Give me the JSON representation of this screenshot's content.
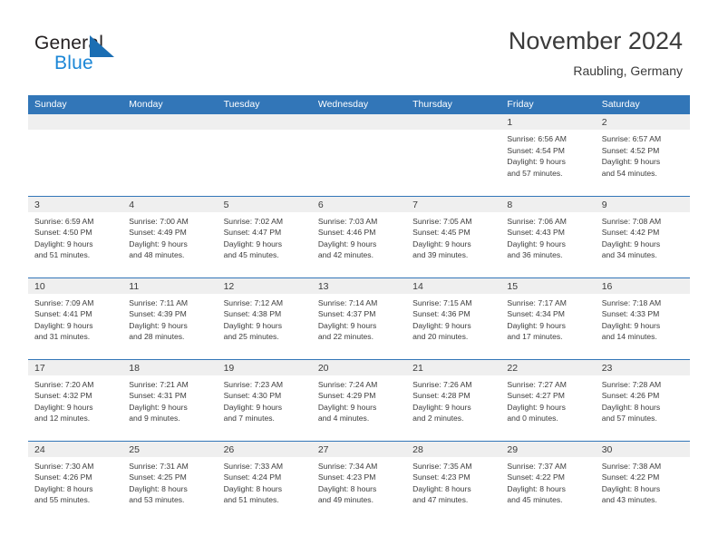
{
  "logo": {
    "word_one": "General",
    "word_two": "Blue",
    "triangle_color": "#1b6eb3",
    "word_two_color": "#1b86d6"
  },
  "header": {
    "title": "November 2024",
    "subtitle": "Raubling, Germany"
  },
  "colors": {
    "header_bar": "#3276b8",
    "daynum_band": "#efefef",
    "row_divider": "#3276b8",
    "text": "#3b3b3b"
  },
  "weekday_headers": [
    "Sunday",
    "Monday",
    "Tuesday",
    "Wednesday",
    "Thursday",
    "Friday",
    "Saturday"
  ],
  "weeks": [
    [
      {
        "day": "",
        "empty": true,
        "sunrise": "",
        "sunset": "",
        "daylight_line1": "",
        "daylight_line2": ""
      },
      {
        "day": "",
        "empty": true,
        "sunrise": "",
        "sunset": "",
        "daylight_line1": "",
        "daylight_line2": ""
      },
      {
        "day": "",
        "empty": true,
        "sunrise": "",
        "sunset": "",
        "daylight_line1": "",
        "daylight_line2": ""
      },
      {
        "day": "",
        "empty": true,
        "sunrise": "",
        "sunset": "",
        "daylight_line1": "",
        "daylight_line2": ""
      },
      {
        "day": "",
        "empty": true,
        "sunrise": "",
        "sunset": "",
        "daylight_line1": "",
        "daylight_line2": ""
      },
      {
        "day": "1",
        "empty": false,
        "sunrise": "Sunrise: 6:56 AM",
        "sunset": "Sunset: 4:54 PM",
        "daylight_line1": "Daylight: 9 hours",
        "daylight_line2": "and 57 minutes."
      },
      {
        "day": "2",
        "empty": false,
        "sunrise": "Sunrise: 6:57 AM",
        "sunset": "Sunset: 4:52 PM",
        "daylight_line1": "Daylight: 9 hours",
        "daylight_line2": "and 54 minutes."
      }
    ],
    [
      {
        "day": "3",
        "empty": false,
        "sunrise": "Sunrise: 6:59 AM",
        "sunset": "Sunset: 4:50 PM",
        "daylight_line1": "Daylight: 9 hours",
        "daylight_line2": "and 51 minutes."
      },
      {
        "day": "4",
        "empty": false,
        "sunrise": "Sunrise: 7:00 AM",
        "sunset": "Sunset: 4:49 PM",
        "daylight_line1": "Daylight: 9 hours",
        "daylight_line2": "and 48 minutes."
      },
      {
        "day": "5",
        "empty": false,
        "sunrise": "Sunrise: 7:02 AM",
        "sunset": "Sunset: 4:47 PM",
        "daylight_line1": "Daylight: 9 hours",
        "daylight_line2": "and 45 minutes."
      },
      {
        "day": "6",
        "empty": false,
        "sunrise": "Sunrise: 7:03 AM",
        "sunset": "Sunset: 4:46 PM",
        "daylight_line1": "Daylight: 9 hours",
        "daylight_line2": "and 42 minutes."
      },
      {
        "day": "7",
        "empty": false,
        "sunrise": "Sunrise: 7:05 AM",
        "sunset": "Sunset: 4:45 PM",
        "daylight_line1": "Daylight: 9 hours",
        "daylight_line2": "and 39 minutes."
      },
      {
        "day": "8",
        "empty": false,
        "sunrise": "Sunrise: 7:06 AM",
        "sunset": "Sunset: 4:43 PM",
        "daylight_line1": "Daylight: 9 hours",
        "daylight_line2": "and 36 minutes."
      },
      {
        "day": "9",
        "empty": false,
        "sunrise": "Sunrise: 7:08 AM",
        "sunset": "Sunset: 4:42 PM",
        "daylight_line1": "Daylight: 9 hours",
        "daylight_line2": "and 34 minutes."
      }
    ],
    [
      {
        "day": "10",
        "empty": false,
        "sunrise": "Sunrise: 7:09 AM",
        "sunset": "Sunset: 4:41 PM",
        "daylight_line1": "Daylight: 9 hours",
        "daylight_line2": "and 31 minutes."
      },
      {
        "day": "11",
        "empty": false,
        "sunrise": "Sunrise: 7:11 AM",
        "sunset": "Sunset: 4:39 PM",
        "daylight_line1": "Daylight: 9 hours",
        "daylight_line2": "and 28 minutes."
      },
      {
        "day": "12",
        "empty": false,
        "sunrise": "Sunrise: 7:12 AM",
        "sunset": "Sunset: 4:38 PM",
        "daylight_line1": "Daylight: 9 hours",
        "daylight_line2": "and 25 minutes."
      },
      {
        "day": "13",
        "empty": false,
        "sunrise": "Sunrise: 7:14 AM",
        "sunset": "Sunset: 4:37 PM",
        "daylight_line1": "Daylight: 9 hours",
        "daylight_line2": "and 22 minutes."
      },
      {
        "day": "14",
        "empty": false,
        "sunrise": "Sunrise: 7:15 AM",
        "sunset": "Sunset: 4:36 PM",
        "daylight_line1": "Daylight: 9 hours",
        "daylight_line2": "and 20 minutes."
      },
      {
        "day": "15",
        "empty": false,
        "sunrise": "Sunrise: 7:17 AM",
        "sunset": "Sunset: 4:34 PM",
        "daylight_line1": "Daylight: 9 hours",
        "daylight_line2": "and 17 minutes."
      },
      {
        "day": "16",
        "empty": false,
        "sunrise": "Sunrise: 7:18 AM",
        "sunset": "Sunset: 4:33 PM",
        "daylight_line1": "Daylight: 9 hours",
        "daylight_line2": "and 14 minutes."
      }
    ],
    [
      {
        "day": "17",
        "empty": false,
        "sunrise": "Sunrise: 7:20 AM",
        "sunset": "Sunset: 4:32 PM",
        "daylight_line1": "Daylight: 9 hours",
        "daylight_line2": "and 12 minutes."
      },
      {
        "day": "18",
        "empty": false,
        "sunrise": "Sunrise: 7:21 AM",
        "sunset": "Sunset: 4:31 PM",
        "daylight_line1": "Daylight: 9 hours",
        "daylight_line2": "and 9 minutes."
      },
      {
        "day": "19",
        "empty": false,
        "sunrise": "Sunrise: 7:23 AM",
        "sunset": "Sunset: 4:30 PM",
        "daylight_line1": "Daylight: 9 hours",
        "daylight_line2": "and 7 minutes."
      },
      {
        "day": "20",
        "empty": false,
        "sunrise": "Sunrise: 7:24 AM",
        "sunset": "Sunset: 4:29 PM",
        "daylight_line1": "Daylight: 9 hours",
        "daylight_line2": "and 4 minutes."
      },
      {
        "day": "21",
        "empty": false,
        "sunrise": "Sunrise: 7:26 AM",
        "sunset": "Sunset: 4:28 PM",
        "daylight_line1": "Daylight: 9 hours",
        "daylight_line2": "and 2 minutes."
      },
      {
        "day": "22",
        "empty": false,
        "sunrise": "Sunrise: 7:27 AM",
        "sunset": "Sunset: 4:27 PM",
        "daylight_line1": "Daylight: 9 hours",
        "daylight_line2": "and 0 minutes."
      },
      {
        "day": "23",
        "empty": false,
        "sunrise": "Sunrise: 7:28 AM",
        "sunset": "Sunset: 4:26 PM",
        "daylight_line1": "Daylight: 8 hours",
        "daylight_line2": "and 57 minutes."
      }
    ],
    [
      {
        "day": "24",
        "empty": false,
        "sunrise": "Sunrise: 7:30 AM",
        "sunset": "Sunset: 4:26 PM",
        "daylight_line1": "Daylight: 8 hours",
        "daylight_line2": "and 55 minutes."
      },
      {
        "day": "25",
        "empty": false,
        "sunrise": "Sunrise: 7:31 AM",
        "sunset": "Sunset: 4:25 PM",
        "daylight_line1": "Daylight: 8 hours",
        "daylight_line2": "and 53 minutes."
      },
      {
        "day": "26",
        "empty": false,
        "sunrise": "Sunrise: 7:33 AM",
        "sunset": "Sunset: 4:24 PM",
        "daylight_line1": "Daylight: 8 hours",
        "daylight_line2": "and 51 minutes."
      },
      {
        "day": "27",
        "empty": false,
        "sunrise": "Sunrise: 7:34 AM",
        "sunset": "Sunset: 4:23 PM",
        "daylight_line1": "Daylight: 8 hours",
        "daylight_line2": "and 49 minutes."
      },
      {
        "day": "28",
        "empty": false,
        "sunrise": "Sunrise: 7:35 AM",
        "sunset": "Sunset: 4:23 PM",
        "daylight_line1": "Daylight: 8 hours",
        "daylight_line2": "and 47 minutes."
      },
      {
        "day": "29",
        "empty": false,
        "sunrise": "Sunrise: 7:37 AM",
        "sunset": "Sunset: 4:22 PM",
        "daylight_line1": "Daylight: 8 hours",
        "daylight_line2": "and 45 minutes."
      },
      {
        "day": "30",
        "empty": false,
        "sunrise": "Sunrise: 7:38 AM",
        "sunset": "Sunset: 4:22 PM",
        "daylight_line1": "Daylight: 8 hours",
        "daylight_line2": "and 43 minutes."
      }
    ]
  ]
}
